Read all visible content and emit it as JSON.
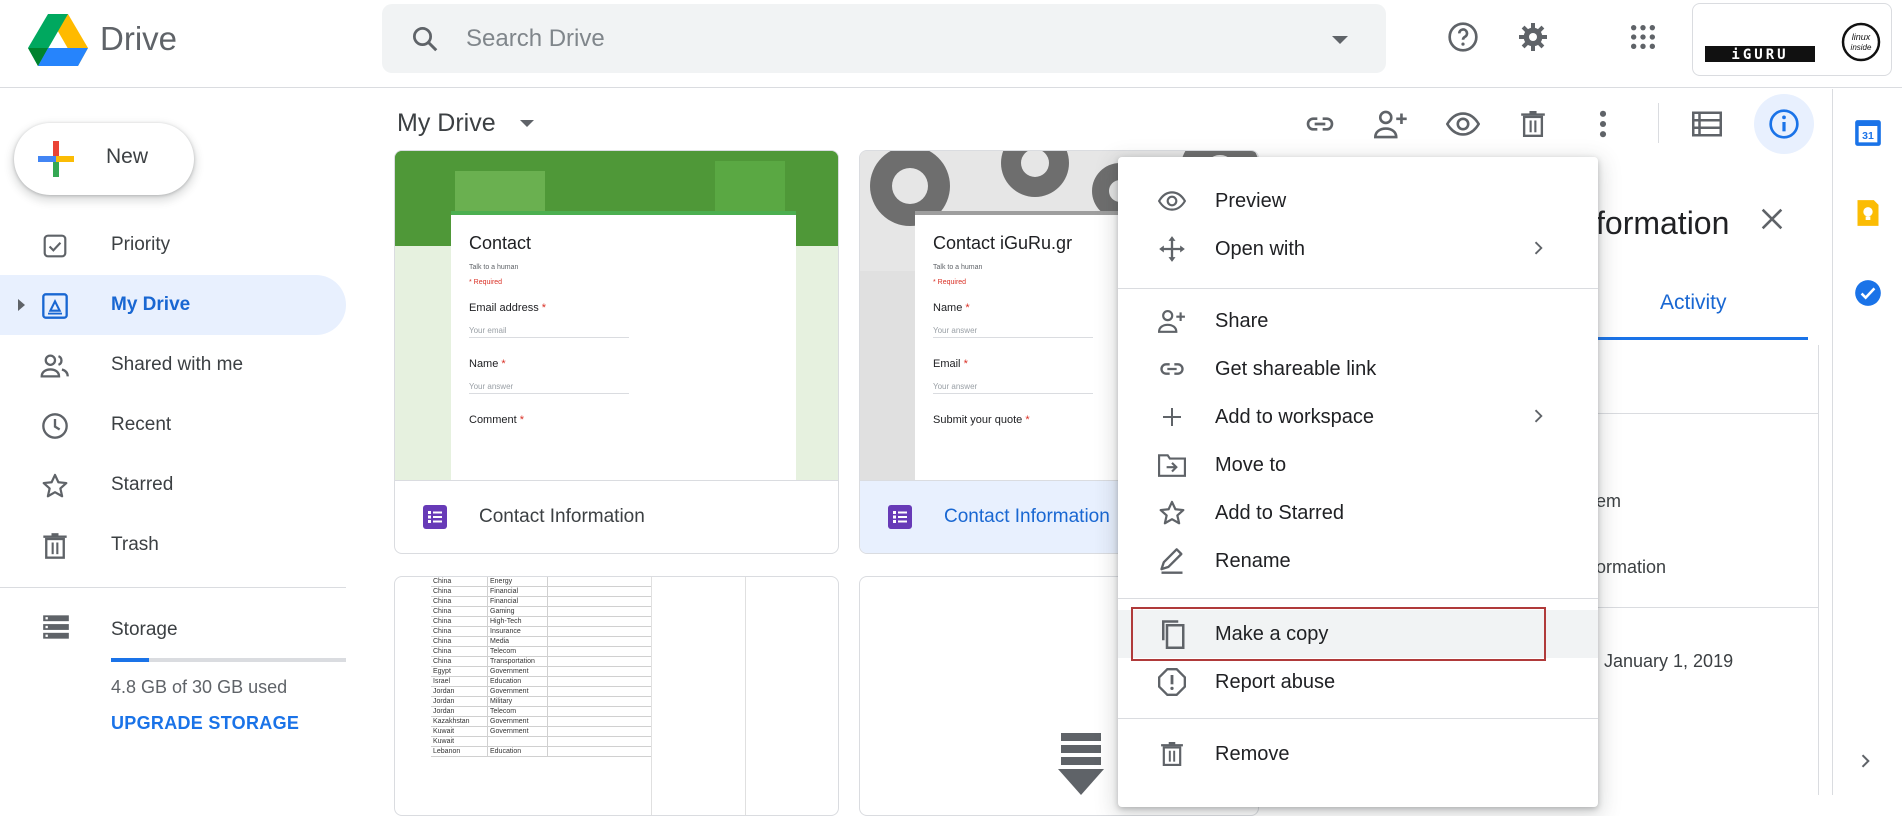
{
  "app": {
    "brand": "Drive"
  },
  "search": {
    "placeholder": "Search Drive"
  },
  "sidebar": {
    "new_label": "New",
    "items": [
      {
        "label": "Priority",
        "icon": "priority-checkbox-icon"
      },
      {
        "label": "My Drive",
        "icon": "my-drive-icon",
        "active": true
      },
      {
        "label": "Shared with me",
        "icon": "people-icon"
      },
      {
        "label": "Recent",
        "icon": "clock-icon"
      },
      {
        "label": "Starred",
        "icon": "star-icon"
      },
      {
        "label": "Trash",
        "icon": "trash-icon"
      }
    ],
    "storage": {
      "label": "Storage",
      "used_text": "4.8 GB of 30 GB used",
      "used_fraction": 0.16,
      "upgrade_label": "UPGRADE STORAGE"
    }
  },
  "toolbar": {
    "title": "My Drive",
    "buttons": [
      "link-icon",
      "add-person-icon",
      "eye-icon",
      "trash-icon",
      "more-vert-icon",
      "list-view-icon",
      "info-icon"
    ]
  },
  "files": [
    {
      "name": "Contact Information",
      "type": "form",
      "form_title": "Contact",
      "subtitle": "Talk to a human",
      "required": "* Required",
      "fields": [
        "Email address",
        "Name",
        "Comment"
      ],
      "answer_placeholders": [
        "Your email",
        "Your answer"
      ]
    },
    {
      "name": "Contact Information",
      "type": "form",
      "selected": true,
      "form_title": "Contact iGuRu.gr",
      "subtitle": "Talk to a human",
      "required": "* Required",
      "fields": [
        "Name",
        "Email",
        "Submit your quote"
      ],
      "answer_placeholders": [
        "Your answer"
      ]
    }
  ],
  "spreadsheet_rows": [
    [
      "China",
      "Energy"
    ],
    [
      "China",
      "Financial"
    ],
    [
      "China",
      "Financial"
    ],
    [
      "China",
      "Gaming"
    ],
    [
      "China",
      "High-Tech"
    ],
    [
      "China",
      "Insurance"
    ],
    [
      "China",
      "Media"
    ],
    [
      "China",
      "Telecom"
    ],
    [
      "China",
      "Transportation"
    ],
    [
      "Egypt",
      "Government"
    ],
    [
      "Israel",
      "Education"
    ],
    [
      "Jordan",
      "Government"
    ],
    [
      "Jordan",
      "Military"
    ],
    [
      "Jordan",
      "Telecom"
    ],
    [
      "Kazakhstan",
      "Government"
    ],
    [
      "Kuwait",
      "Government"
    ],
    [
      "Kuwait",
      ""
    ],
    [
      "Lebanon",
      "Education"
    ]
  ],
  "context_menu": {
    "items": [
      {
        "label": "Preview",
        "icon": "eye-icon"
      },
      {
        "label": "Open with",
        "icon": "move-arrows-icon",
        "submenu": true
      },
      {
        "label": "Share",
        "icon": "add-person-icon"
      },
      {
        "label": "Get shareable link",
        "icon": "link-icon"
      },
      {
        "label": "Add to workspace",
        "icon": "plus-icon",
        "submenu": true
      },
      {
        "label": "Move to",
        "icon": "move-to-folder-icon"
      },
      {
        "label": "Add to Starred",
        "icon": "star-icon"
      },
      {
        "label": "Rename",
        "icon": "pencil-icon"
      },
      {
        "label": "Make a copy",
        "icon": "copy-icon",
        "highlighted": true
      },
      {
        "label": "Report abuse",
        "icon": "alert-icon"
      },
      {
        "label": "Remove",
        "icon": "trash-icon"
      }
    ]
  },
  "details": {
    "title_fragment": "formation",
    "tab": "Activity",
    "text_1": "em",
    "text_2": "ormation",
    "date": "January 1, 2019"
  },
  "side_apps": [
    "calendar-icon",
    "keep-icon",
    "tasks-icon"
  ],
  "account": {
    "brand_text": "iGURU",
    "badge_text": "linux inside"
  }
}
